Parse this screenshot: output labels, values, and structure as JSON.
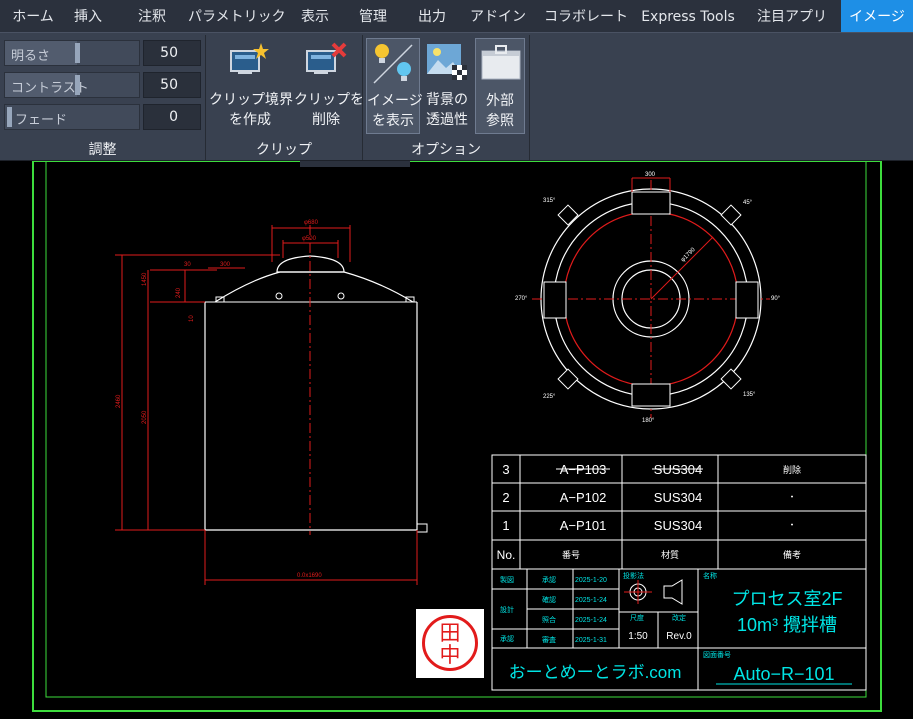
{
  "tabs": [
    {
      "label": "ホーム"
    },
    {
      "label": "挿入"
    },
    {
      "label": "注釈"
    },
    {
      "label": "パラメトリック"
    },
    {
      "label": "表示"
    },
    {
      "label": "管理"
    },
    {
      "label": "出力"
    },
    {
      "label": "アドイン"
    },
    {
      "label": "コラボレート"
    },
    {
      "label": "Express Tools"
    },
    {
      "label": "注目アプリ"
    },
    {
      "label": "イメージ",
      "active": true
    }
  ],
  "adjust_panel": {
    "title": "調整",
    "brightness": {
      "label": "明るさ",
      "value": "50",
      "level": 0.5
    },
    "contrast": {
      "label": "コントラスト",
      "value": "50",
      "level": 0.5
    },
    "fade": {
      "label": "フェード",
      "value": "0",
      "level": 0
    }
  },
  "clip_panel": {
    "title": "クリップ",
    "create_line1": "クリップ境界",
    "create_line2": "を作成",
    "delete_line1": "クリップを",
    "delete_line2": "削除"
  },
  "options_panel": {
    "title": "オプション",
    "show_line1": "イメージ",
    "show_line2": "を表示",
    "transp_line1": "背景の",
    "transp_line2": "透過性",
    "xref_line1": "外部",
    "xref_line2": "参照"
  },
  "colors": {
    "accent_tab": "#1e8fe6",
    "drawing_line": "#ffffff",
    "dimension": "#e01b1b",
    "annotation": "#00e5e5",
    "frame": "#3ddc3d",
    "stamp": "#e21b1b"
  },
  "drawing": {
    "tank_dims": {
      "top_outer": "φ680",
      "top_inner": "φ500",
      "offset1": "30",
      "offset2": "300",
      "h1": "1450",
      "h2": "240",
      "h3": "10",
      "height_total": "2460",
      "height_body": "2050",
      "width": "0.0x1690"
    },
    "plan_dims": {
      "top": "300",
      "diameter": "φ1790",
      "angle_tl": "315°",
      "angle_tr": "45°",
      "angle_l": "270°",
      "angle_r": "90°",
      "angle_bl": "225°",
      "angle_br": "135°",
      "angle_b": "180°"
    },
    "parts_table": [
      {
        "no": "3",
        "code": "A−P103",
        "material": "SUS304",
        "note": "削除"
      },
      {
        "no": "2",
        "code": "A−P102",
        "material": "SUS304",
        "note": "・"
      },
      {
        "no": "1",
        "code": "A−P101",
        "material": "SUS304",
        "note": "・"
      }
    ],
    "parts_header": {
      "no": "No.",
      "code": "番号",
      "material": "材質",
      "note": "備考"
    },
    "title_block": {
      "roles": [
        {
          "role": "製図",
          "sub": "承認",
          "date": "2025-1-20"
        },
        {
          "role": "設計",
          "sub": "確認",
          "date": "2025-1-24"
        },
        {
          "role": "",
          "sub": "照合",
          "date": "2025-1-24"
        },
        {
          "role": "承認",
          "sub": "審査",
          "date": "2025-1-31"
        }
      ],
      "method_label": "投影法",
      "scale_label": "尺度",
      "scale": "1:50",
      "rev_label": "改定",
      "rev": "Rev.0",
      "name_label": "名称",
      "name_line1": "プロセス室2F",
      "name_line2": "10m³ 攪拌槽",
      "company": "おーとめーとラボ.com",
      "drawing_no_label": "図面番号",
      "drawing_no": "Auto−R−101"
    },
    "stamp_top": "田",
    "stamp_bottom": "中"
  }
}
